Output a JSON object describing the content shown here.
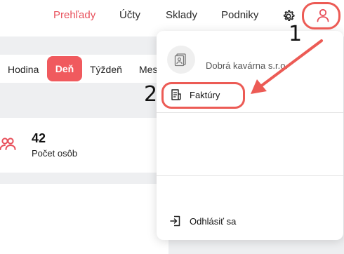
{
  "nav": {
    "items": [
      "Prehľady",
      "Účty",
      "Sklady",
      "Podniky"
    ],
    "active_color": "#e8505b"
  },
  "periods": {
    "items": [
      "Hodina",
      "Deň",
      "Týždeň",
      "Mes"
    ],
    "active": "Deň",
    "accent": "#f05a5e"
  },
  "stat": {
    "value": "42",
    "label": "Počet osôb",
    "icon": "people-icon"
  },
  "dropdown": {
    "company": "Dobrá kavárna s.r.o.",
    "invoices": "Faktúry",
    "logout": "Odhlásiť sa"
  },
  "annotations": {
    "step1": "1",
    "step2": "2",
    "color": "#ec5b55"
  }
}
